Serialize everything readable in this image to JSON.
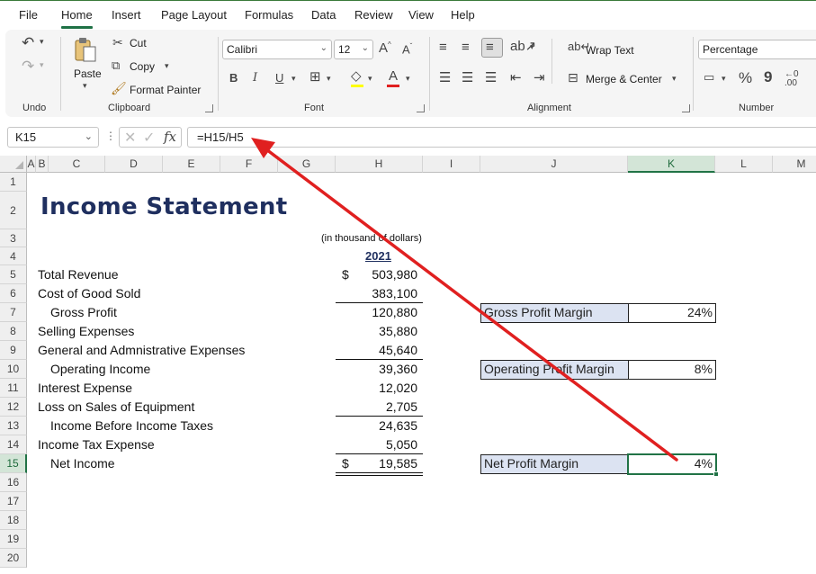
{
  "menu": {
    "items": [
      "File",
      "Home",
      "Insert",
      "Page Layout",
      "Formulas",
      "Data",
      "Review",
      "View",
      "Help"
    ],
    "active": "Home"
  },
  "ribbon": {
    "undo": {
      "label": "Undo"
    },
    "clipboard": {
      "label": "Clipboard",
      "paste": "Paste",
      "cut": "Cut",
      "copy": "Copy",
      "format_painter": "Format Painter"
    },
    "font": {
      "label": "Font",
      "font_name": "Calibri",
      "font_size": "12",
      "bold": "B",
      "italic": "I",
      "underline": "U",
      "grow": "A",
      "shrink": "A",
      "font_color_letter": "A"
    },
    "alignment": {
      "label": "Alignment",
      "wrap_text": "Wrap Text",
      "merge_center": "Merge & Center"
    },
    "number": {
      "label": "Number",
      "format": "Percentage",
      "percent": "%",
      "comma": "9",
      "inc_decimal": "←0 .00"
    }
  },
  "formula_bar": {
    "name_box": "K15",
    "formula": "=H15/H5",
    "fx": "fx"
  },
  "grid": {
    "columns": [
      "A",
      "B",
      "C",
      "D",
      "E",
      "F",
      "G",
      "H",
      "I",
      "J",
      "K",
      "L",
      "M"
    ],
    "selected_column": "K",
    "rows": [
      "1",
      "2",
      "3",
      "4",
      "5",
      "6",
      "7",
      "8",
      "9",
      "10",
      "11",
      "12",
      "13",
      "14",
      "15",
      "16",
      "17",
      "18",
      "19",
      "20"
    ],
    "selected_row": "15"
  },
  "sheet": {
    "title": "Income Statement",
    "units_note": "(in thousand of dollars)",
    "year_header": "2021",
    "lines": [
      {
        "row": "5",
        "label": "Total Revenue",
        "currency": "$",
        "value": "503,980",
        "indent": false
      },
      {
        "row": "6",
        "label": "Cost of Good Sold",
        "currency": "",
        "value": "383,100",
        "indent": false
      },
      {
        "row": "7",
        "label": "Gross Profit",
        "currency": "",
        "value": "120,880",
        "indent": true
      },
      {
        "row": "8",
        "label": "Selling Expenses",
        "currency": "",
        "value": "35,880",
        "indent": false
      },
      {
        "row": "9",
        "label": "General and Admnistrative Expenses",
        "currency": "",
        "value": "45,640",
        "indent": false
      },
      {
        "row": "10",
        "label": "Operating Income",
        "currency": "",
        "value": "39,360",
        "indent": true
      },
      {
        "row": "11",
        "label": "Interest Expense",
        "currency": "",
        "value": "12,020",
        "indent": false
      },
      {
        "row": "12",
        "label": "Loss on Sales of Equipment",
        "currency": "",
        "value": "2,705",
        "indent": false
      },
      {
        "row": "13",
        "label": "Income Before Income Taxes",
        "currency": "",
        "value": "24,635",
        "indent": true
      },
      {
        "row": "14",
        "label": "Income Tax Expense",
        "currency": "",
        "value": "5,050",
        "indent": false
      },
      {
        "row": "15",
        "label": "Net Income",
        "currency": "$",
        "value": "19,585",
        "indent": true
      }
    ],
    "ratios": [
      {
        "row": "7",
        "label": "Gross Profit Margin",
        "value": "24%"
      },
      {
        "row": "10",
        "label": "Operating Profit Margin",
        "value": "8%"
      },
      {
        "row": "15",
        "label": "Net Profit Margin",
        "value": "4%"
      }
    ]
  },
  "colors": {
    "accent_green": "#217346",
    "title_navy": "#1f2f5f",
    "ratio_fill": "#dce3f2",
    "annotation_arrow": "#e02020"
  }
}
